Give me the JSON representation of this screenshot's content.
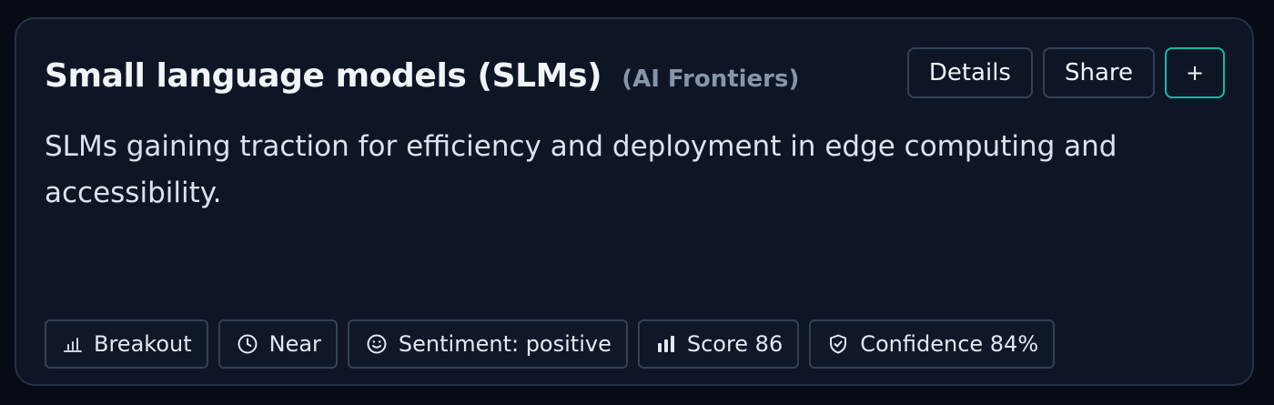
{
  "card": {
    "title": "Small language models (SLMs)",
    "category": "(AI Frontiers)",
    "description": "SLMs gaining traction for efficiency and deployment in edge computing and accessibility."
  },
  "actions": {
    "details_label": "Details",
    "share_label": "Share",
    "add_label": "+"
  },
  "tags": [
    {
      "icon": "bar-chart-icon",
      "label": "Breakout"
    },
    {
      "icon": "clock-icon",
      "label": "Near"
    },
    {
      "icon": "smile-icon",
      "label": "Sentiment: positive"
    },
    {
      "icon": "bar-chart-solid-icon",
      "label": "Score 86"
    },
    {
      "icon": "shield-check-icon",
      "label": "Confidence 84%"
    }
  ],
  "colors": {
    "background": "#060b16",
    "card": "#0e1626",
    "border": "#334155",
    "accent": "#14b8a6",
    "muted_text": "#8695ab"
  }
}
